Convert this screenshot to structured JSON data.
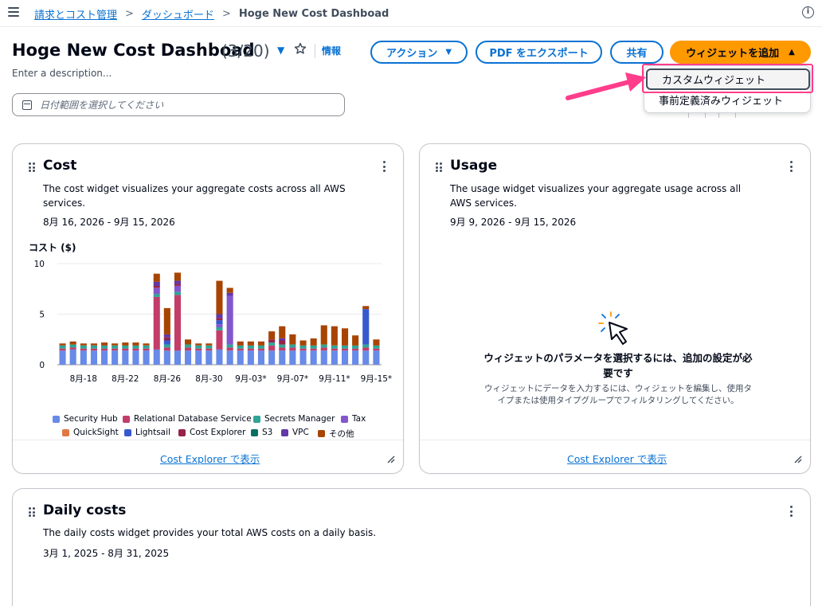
{
  "breadcrumb": {
    "items": [
      "請求とコスト管理",
      "ダッシュボード"
    ],
    "current": "Hoge New Cost Dashboad"
  },
  "header": {
    "title": "Hoge New Cost Dashboad",
    "count": "(3/20)",
    "info": "情報",
    "description": "Enter a description..."
  },
  "actions": {
    "action": "アクション",
    "export": "PDF をエクスポート",
    "share": "共有",
    "add_widget": "ウィジェットを追加"
  },
  "date_filter": {
    "placeholder": "日付範囲を選択してください"
  },
  "dropdown": {
    "items": [
      "カスタムウィジェット",
      "事前定義済みウィジェット"
    ]
  },
  "cost_card": {
    "title": "Cost",
    "description_line1": "The cost widget visualizes your aggregate costs across all AWS",
    "description_line2": "services.",
    "date_range": "8月 16, 2026 - 9月 15, 2026",
    "footer_link": "Cost Explorer で表示"
  },
  "usage_card": {
    "title": "Usage",
    "description_line1": "The usage widget visualizes your aggregate usage across all",
    "description_line2": "AWS services.",
    "date_range": "9月 9, 2026 - 9月 15, 2026",
    "empty_title_line1": "ウィジェットのパラメータを選択するには、追加の設定が必",
    "empty_title_line2": "要です",
    "empty_desc_line1": "ウィジェットにデータを入力するには、ウィジェットを編集し、使用タ",
    "empty_desc_line2": "イプまたは使用タイプグループでフィルタリングしてください。",
    "footer_link": "Cost Explorer で表示"
  },
  "daily_card": {
    "title": "Daily costs",
    "description": "The daily costs widget provides your total AWS costs on a daily basis.",
    "date_range": "3月 1, 2025 - 8月 31, 2025"
  },
  "chart_data": {
    "type": "bar",
    "stacked": true,
    "ylabel": "コスト ($)",
    "ylim": [
      0,
      10
    ],
    "yticks": [
      "10",
      "5",
      "0"
    ],
    "xtick_labels": [
      "8月-18",
      "8月-22",
      "8月-26",
      "8月-30",
      "9月-03*",
      "9月-07*",
      "9月-11*",
      "9月-15*"
    ],
    "categories": [
      "8/16",
      "8/17",
      "8/18",
      "8/19",
      "8/20",
      "8/21",
      "8/22",
      "8/23",
      "8/24",
      "8/25",
      "8/26",
      "8/27",
      "8/28",
      "8/29",
      "8/30",
      "8/31",
      "9/01",
      "9/02",
      "9/03",
      "9/04",
      "9/05",
      "9/06",
      "9/07",
      "9/08",
      "9/09",
      "9/10",
      "9/11",
      "9/12",
      "9/13",
      "9/14",
      "9/15"
    ],
    "series": [
      {
        "name": "Security Hub",
        "color": "#688ae8",
        "values": [
          1.4,
          1.5,
          1.4,
          1.4,
          1.4,
          1.4,
          1.4,
          1.4,
          1.4,
          1.5,
          1.4,
          1.4,
          1.4,
          1.4,
          1.4,
          1.5,
          1.4,
          1.4,
          1.4,
          1.4,
          1.4,
          1.4,
          1.4,
          1.4,
          1.4,
          1.4,
          1.4,
          1.4,
          1.4,
          1.4,
          1.4
        ]
      },
      {
        "name": "Relational Database Service",
        "color": "#c33d69",
        "values": [
          0.2,
          0.2,
          0.2,
          0.2,
          0.2,
          0.2,
          0.2,
          0.2,
          0.2,
          5.2,
          0.3,
          5.5,
          0.3,
          0.2,
          0.2,
          1.9,
          0.3,
          0.2,
          0.2,
          0.2,
          0.5,
          0.3,
          0.3,
          0.2,
          0.2,
          0.3,
          0.2,
          0.2,
          0.2,
          0.3,
          0.2
        ]
      },
      {
        "name": "Secrets Manager",
        "color": "#2ea597",
        "values": [
          0.3,
          0.3,
          0.3,
          0.3,
          0.3,
          0.3,
          0.3,
          0.3,
          0.3,
          0.3,
          0.3,
          0.3,
          0.3,
          0.3,
          0.3,
          0.3,
          0.3,
          0.3,
          0.3,
          0.3,
          0.3,
          0.3,
          0.3,
          0.3,
          0.3,
          0.3,
          0.3,
          0.3,
          0.3,
          0.3,
          0.3
        ]
      },
      {
        "name": "Tax",
        "color": "#8456ce",
        "values": [
          0,
          0,
          0,
          0,
          0,
          0,
          0,
          0,
          0,
          0.6,
          0,
          0.6,
          0,
          0,
          0,
          0.3,
          4.8,
          0,
          0,
          0,
          0,
          0,
          0,
          0,
          0,
          0,
          0,
          0,
          0,
          0,
          0
        ]
      },
      {
        "name": "QuickSight",
        "color": "#e07941",
        "values": [
          0,
          0,
          0,
          0,
          0,
          0,
          0,
          0,
          0,
          0,
          0,
          0,
          0,
          0,
          0,
          0,
          0,
          0,
          0,
          0,
          0,
          0,
          0,
          0,
          0,
          0,
          0,
          0,
          0,
          0,
          0
        ]
      },
      {
        "name": "Lightsail",
        "color": "#3759ce",
        "values": [
          0,
          0,
          0,
          0,
          0,
          0,
          0,
          0,
          0,
          0,
          0.4,
          0,
          0,
          0,
          0,
          0.4,
          0,
          0,
          0,
          0,
          0,
          0,
          0,
          0,
          0,
          0,
          0,
          0,
          0,
          3.5,
          0
        ]
      },
      {
        "name": "Cost Explorer",
        "color": "#962249",
        "values": [
          0,
          0,
          0,
          0,
          0,
          0,
          0,
          0,
          0,
          0.2,
          0.3,
          0.2,
          0,
          0,
          0,
          0.2,
          0,
          0,
          0,
          0,
          0.3,
          0.4,
          0,
          0,
          0,
          0,
          0,
          0,
          0,
          0,
          0
        ]
      },
      {
        "name": "S3",
        "color": "#096f64",
        "values": [
          0,
          0,
          0,
          0,
          0,
          0,
          0,
          0,
          0,
          0,
          0,
          0,
          0,
          0,
          0,
          0,
          0,
          0,
          0,
          0,
          0,
          0,
          0,
          0,
          0,
          0,
          0,
          0,
          0,
          0,
          0
        ]
      },
      {
        "name": "VPC",
        "color": "#6237a7",
        "values": [
          0,
          0,
          0,
          0,
          0,
          0,
          0,
          0,
          0,
          0.4,
          0.3,
          0.3,
          0,
          0,
          0,
          0.4,
          0.3,
          0,
          0,
          0,
          0,
          0.2,
          0,
          0,
          0,
          0,
          0,
          0,
          0,
          0,
          0
        ]
      },
      {
        "name": "その他",
        "color": "#a84401",
        "values": [
          0.2,
          0.3,
          0.2,
          0.2,
          0.3,
          0.2,
          0.3,
          0.3,
          0.2,
          0.8,
          2.6,
          0.8,
          0.5,
          0.2,
          0.2,
          3.3,
          0.5,
          0.4,
          0.4,
          0.4,
          0.8,
          1.2,
          1.0,
          0.5,
          0.7,
          1.9,
          1.9,
          1.7,
          1.0,
          0.3,
          0.6
        ]
      }
    ]
  }
}
